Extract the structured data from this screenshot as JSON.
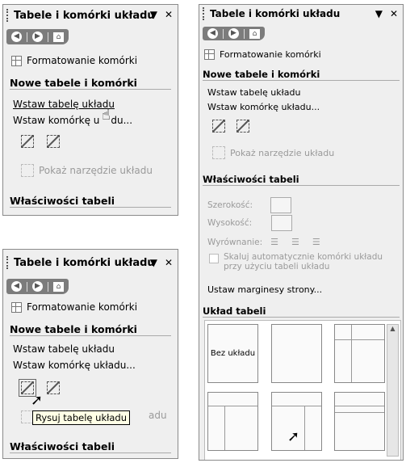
{
  "panels": {
    "top_left": {
      "title": "Tabele i komórki układu",
      "format_link": "Formatowanie komórki",
      "section1": "Nowe tabele i komórki",
      "insert_table": "Wstaw tabelę układu",
      "insert_cell": "Wstaw komórkę u",
      "insert_cell_tail": "du...",
      "show_tool": "Pokaż narzędzie układu",
      "section2": "Właściwości tabeli"
    },
    "bottom_left": {
      "title": "Tabele i komórki układu",
      "format_link": "Formatowanie komórki",
      "section1": "Nowe tabele i komórki",
      "insert_table": "Wstaw tabelę układu",
      "insert_cell": "Wstaw komórkę układu...",
      "tooltip": "Rysuj tabelę układu",
      "show_tool_tail": "adu",
      "section2": "Właściwości tabeli"
    },
    "right": {
      "title": "Tabele i komórki układu",
      "format_link": "Formatowanie komórki",
      "section1": "Nowe tabele i komórki",
      "insert_table": "Wstaw tabelę układu",
      "insert_cell": "Wstaw komórkę układu...",
      "show_tool": "Pokaż narzędzie układu",
      "section2": "Właściwości tabeli",
      "width_label": "Szerokość:",
      "height_label": "Wysokość:",
      "align_label": "Wyrównanie:",
      "autoscale": "Skaluj automatycznie komórki układu przy użyciu tabeli układu",
      "margins": "Ustaw marginesy strony...",
      "section3": "Układ tabeli",
      "no_layout": "Bez układu"
    }
  },
  "icons": {
    "back": "back-arrow-icon",
    "forward": "forward-arrow-icon",
    "home": "home-icon",
    "dropdown": "dropdown-triangle-icon",
    "close": "close-icon",
    "cell_format": "cell-format-icon",
    "draw_table": "draw-layout-table-icon",
    "draw_cell": "draw-layout-cell-icon",
    "mouse_cursor": "mouse-pointer-icon"
  }
}
